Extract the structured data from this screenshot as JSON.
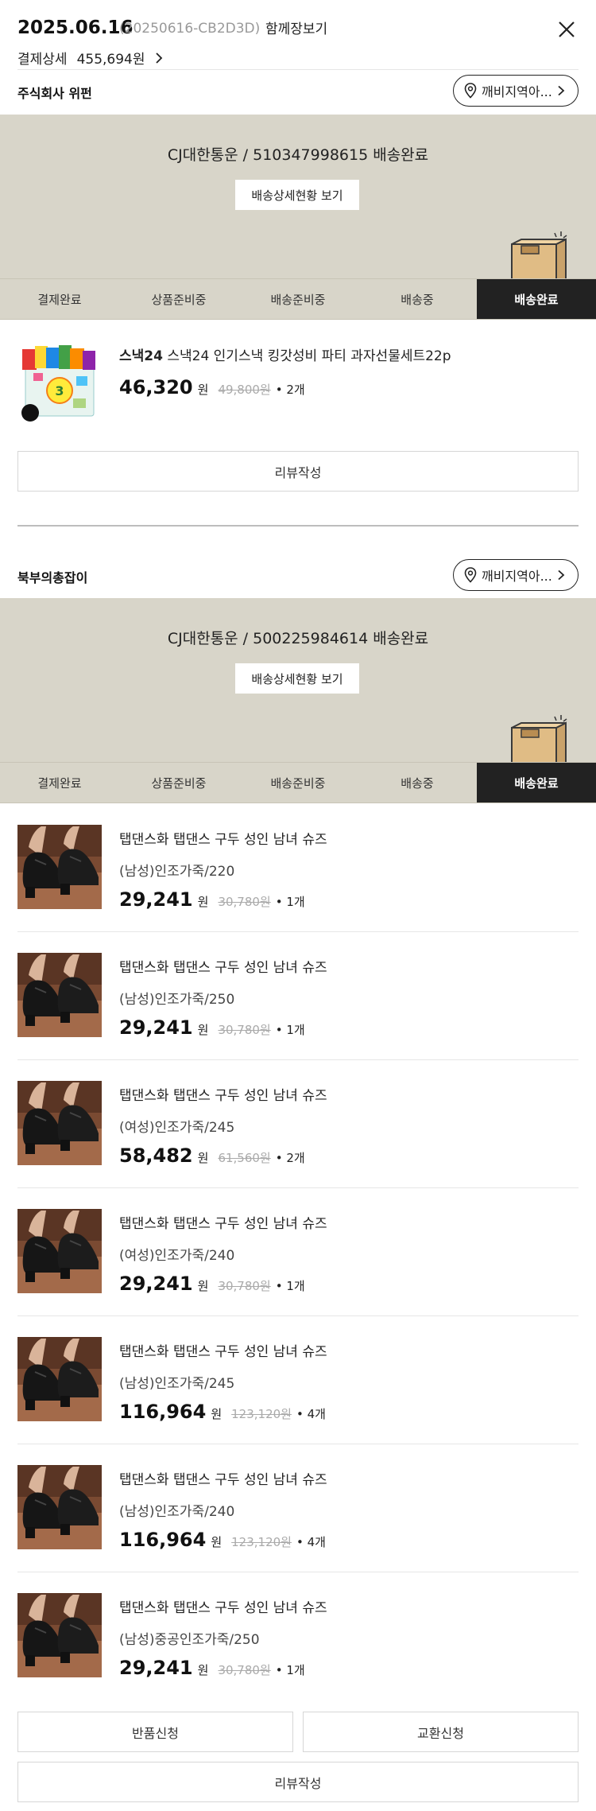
{
  "header": {
    "order_date": "2025.06.16",
    "order_code": "(20250616-CB2D3D)",
    "view_together": "함께장보기",
    "payment_label": "결제상세",
    "payment_amount": "455,694원"
  },
  "tab_labels": [
    "결제완료",
    "상품준비중",
    "배송준비중",
    "배송중",
    "배송완료"
  ],
  "groups": [
    {
      "seller": "주식회사 위펀",
      "region": "깨비지역아...",
      "courier": "CJ대한통운 / 510347998615 배송완료",
      "tracking_button": "배송상세현황 보기",
      "active_tab": 4,
      "items": [
        {
          "brand": "스낵24",
          "name": "스낵24 인기스낵 킹갓성비 파티 과자선물세트22p",
          "price": "46,320",
          "won": "원",
          "original": "49,800원",
          "qty": "• 2개"
        }
      ],
      "review_button": "리뷰작성"
    },
    {
      "seller": "북부의총잡이",
      "region": "깨비지역아...",
      "courier": "CJ대한통운 / 500225984614 배송완료",
      "tracking_button": "배송상세현황 보기",
      "active_tab": 4,
      "items": [
        {
          "name": "탭댄스화 탭댄스 구두 성인 남녀 슈즈",
          "option": "(남성)인조가죽/220",
          "price": "29,241",
          "won": "원",
          "original": "30,780원",
          "qty": "• 1개"
        },
        {
          "name": "탭댄스화 탭댄스 구두 성인 남녀 슈즈",
          "option": "(남성)인조가죽/250",
          "price": "29,241",
          "won": "원",
          "original": "30,780원",
          "qty": "• 1개"
        },
        {
          "name": "탭댄스화 탭댄스 구두 성인 남녀 슈즈",
          "option": "(여성)인조가죽/245",
          "price": "58,482",
          "won": "원",
          "original": "61,560원",
          "qty": "• 2개"
        },
        {
          "name": "탭댄스화 탭댄스 구두 성인 남녀 슈즈",
          "option": "(여성)인조가죽/240",
          "price": "29,241",
          "won": "원",
          "original": "30,780원",
          "qty": "• 1개"
        },
        {
          "name": "탭댄스화 탭댄스 구두 성인 남녀 슈즈",
          "option": "(남성)인조가죽/245",
          "price": "116,964",
          "won": "원",
          "original": "123,120원",
          "qty": "• 4개"
        },
        {
          "name": "탭댄스화 탭댄스 구두 성인 남녀 슈즈",
          "option": "(남성)인조가죽/240",
          "price": "116,964",
          "won": "원",
          "original": "123,120원",
          "qty": "• 4개"
        },
        {
          "name": "탭댄스화 탭댄스 구두 성인 남녀 슈즈",
          "option": "(남성)중공인조가죽/250",
          "price": "29,241",
          "won": "원",
          "original": "30,780원",
          "qty": "• 1개"
        }
      ],
      "return_button": "반품신청",
      "exchange_button": "교환신청",
      "review_button": "리뷰작성"
    }
  ],
  "icons": {
    "close": "close-icon",
    "chevron": "chevron-right-icon",
    "location": "location-pin-icon",
    "box": "delivery-box-icon"
  },
  "colors": {
    "banner_bg": "#d8d5c9",
    "active_tab_bg": "#222222",
    "box_color": "#e0bc85"
  }
}
